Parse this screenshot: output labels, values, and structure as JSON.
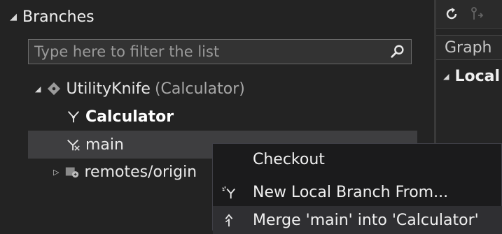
{
  "branches": {
    "header": "Branches",
    "filter_placeholder": "Type here to filter the list",
    "repo": {
      "name": "UtilityKnife",
      "detail": "(Calculator)"
    },
    "items": [
      {
        "label": "Calculator",
        "current": true
      },
      {
        "label": "main",
        "selected": true
      }
    ],
    "remotes": {
      "label": "remotes/origin"
    }
  },
  "right_panel": {
    "tab_graph": "Graph",
    "local_header": "Local"
  },
  "context_menu": {
    "items": [
      {
        "label": "Checkout"
      },
      {
        "label": "New Local Branch From..."
      },
      {
        "label": "Merge 'main' into 'Calculator'"
      }
    ]
  },
  "colors": {
    "background": "#232323",
    "selection": "#3e3e40",
    "menu_bg": "#1b1b1c"
  },
  "icons": [
    "search-icon",
    "refresh-icon",
    "fetch-icon",
    "repo-icon",
    "branch-icon",
    "branch-merge-icon",
    "remote-icon",
    "new-branch-icon",
    "merge-icon"
  ]
}
